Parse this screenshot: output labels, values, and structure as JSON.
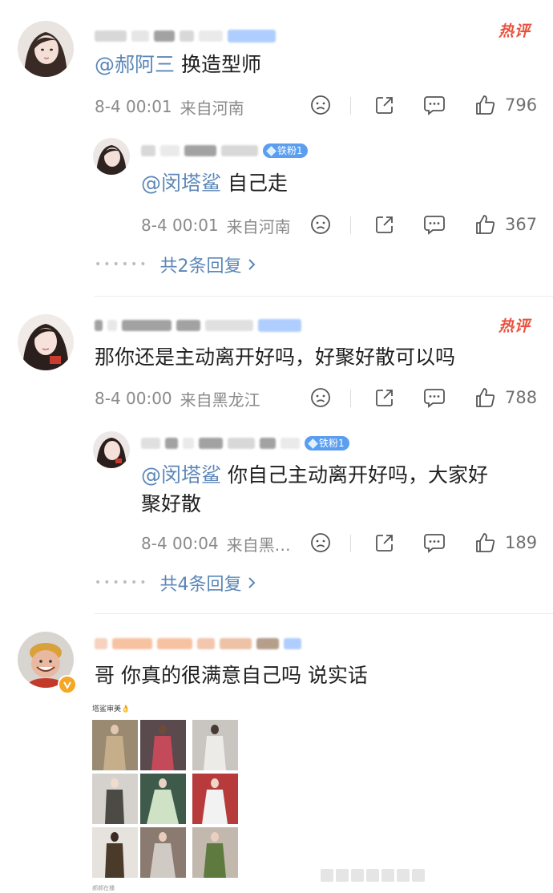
{
  "comments": [
    {
      "hot_label": "热评",
      "mention": "@郝阿三",
      "text": " 换造型师",
      "time": "8-4 00:01",
      "location": "来自河南",
      "likes": "796",
      "reply": {
        "badge": "铁粉1",
        "mention": "@闵塔鲨",
        "text": " 自己走",
        "time": "8-4 00:01",
        "location": "来自河南",
        "likes": "367"
      },
      "more_replies": "共2条回复"
    },
    {
      "hot_label": "热评",
      "mention": "",
      "text": "那你还是主动离开好吗，好聚好散可以吗",
      "time": "8-4 00:00",
      "location": "来自黑龙江",
      "likes": "788",
      "reply": {
        "badge": "铁粉1",
        "mention": "@闵塔鲨",
        "text": " 你自己主动离开好吗，大家好",
        "text_line2": "聚好散",
        "time": "8-4 00:04",
        "location": "来自黑…",
        "likes": "189"
      },
      "more_replies": "共4条回复"
    },
    {
      "text": "哥 你真的很满意自己吗 说实话",
      "image_caption": "塔鲨审美👌",
      "image_footer": "郝郝在播"
    }
  ],
  "icons": [
    "sad-face-icon",
    "share-icon",
    "comment-icon",
    "thumbs-up-icon",
    "chevron-right-icon"
  ],
  "colors": {
    "mention": "#5b87b8",
    "hot": "#e8533f",
    "badge": "#5b9ef0",
    "meta": "#8a8a8a"
  }
}
